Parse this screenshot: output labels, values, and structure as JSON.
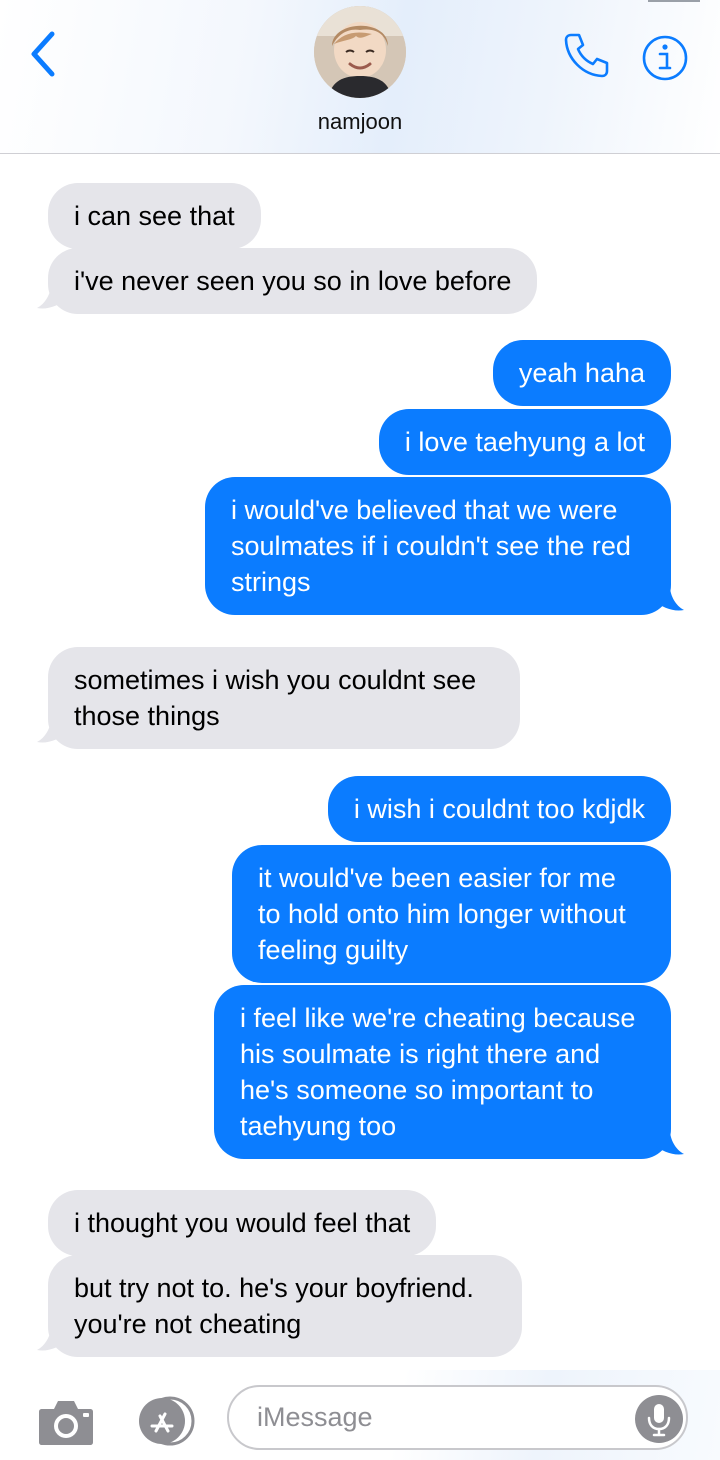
{
  "header": {
    "contact_name": "namjoon",
    "back_icon": "chevron-left-icon",
    "call_icon": "phone-icon",
    "info_icon": "info-icon",
    "accent_color": "#0b7cff"
  },
  "messages": [
    {
      "direction": "incoming",
      "text": "i can see that"
    },
    {
      "direction": "incoming",
      "text": "i've never seen you so in love before"
    },
    {
      "direction": "outgoing",
      "text": "yeah haha"
    },
    {
      "direction": "outgoing",
      "text": "i love taehyung a lot"
    },
    {
      "direction": "outgoing",
      "lines": [
        "i would've believed that we were",
        "soulmates if i couldn't see the red",
        "strings"
      ]
    },
    {
      "direction": "incoming",
      "lines": [
        "sometimes i wish you couldnt see",
        "those things"
      ]
    },
    {
      "direction": "outgoing",
      "text": "i wish i couldnt too kdjdk"
    },
    {
      "direction": "outgoing",
      "lines": [
        "it would've been easier for me",
        "to hold onto him longer without",
        "feeling guilty"
      ]
    },
    {
      "direction": "outgoing",
      "lines": [
        "i feel like we're cheating because",
        "his soulmate is right there and",
        "he's someone so important to",
        "taehyung too"
      ]
    },
    {
      "direction": "incoming",
      "text": "i thought you would feel that"
    },
    {
      "direction": "incoming",
      "lines": [
        "but try not to. he's your boyfriend.",
        "you're not cheating"
      ]
    }
  ],
  "colors": {
    "incoming_bubble": "#e5e5ea",
    "outgoing_bubble": "#0b7cff"
  },
  "composer": {
    "placeholder": "iMessage",
    "camera_icon": "camera-icon",
    "apps_icon": "app-store-icon",
    "mic_icon": "microphone-icon"
  }
}
